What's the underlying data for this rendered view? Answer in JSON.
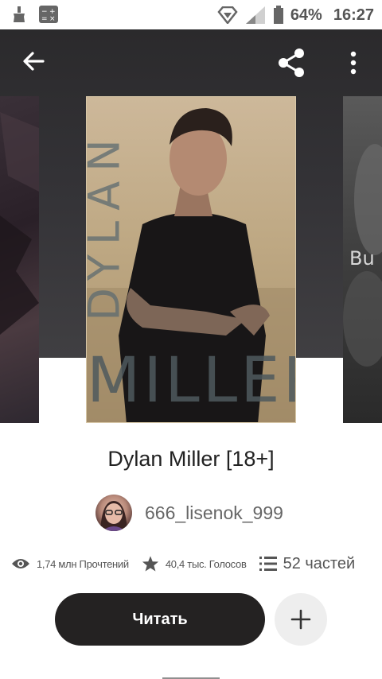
{
  "status_bar": {
    "battery": "64%",
    "time": "16:27"
  },
  "app_bar": {
    "back_icon": "arrow-left-icon",
    "share_icon": "share-icon",
    "more_icon": "more-vert-icon"
  },
  "covers": {
    "main_text_vertical": "DYLAN",
    "main_text_bottom": "MILLER",
    "right_text": "Bu"
  },
  "story": {
    "title": "Dylan Miller [18+]",
    "author": "666_lisenok_999",
    "reads": "1,74 млн Прочтений",
    "votes": "40,4 тыс. Голосов",
    "parts": "52 частей"
  },
  "actions": {
    "read_label": "Читать",
    "add_icon": "plus-icon"
  },
  "colors": {
    "hero_bg": "#2b2a2c",
    "primary_button": "#242222",
    "secondary_button": "#eeeeee"
  }
}
